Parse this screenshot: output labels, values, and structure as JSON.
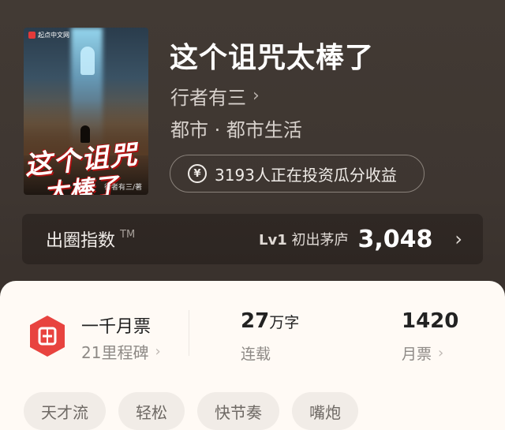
{
  "book": {
    "cover": {
      "brand": "起点中文网",
      "title_line1": "这个诅咒",
      "title_line2": "太棒了",
      "author_tag": "行者有三/著"
    },
    "title": "这个诅咒太棒了",
    "author": "行者有三",
    "category": "都市 · 都市生活",
    "invest_text": "3193人正在投资瓜分收益"
  },
  "index": {
    "label": "出圈指数",
    "tm": "TM",
    "level": "Lv1",
    "level_name": "初出茅庐",
    "value": "3,048"
  },
  "stats": {
    "ticket_title": "一千月票",
    "ticket_sub": "21里程碑",
    "words_value": "27",
    "words_unit": "万字",
    "words_label": "连载",
    "monthly_value": "1420",
    "monthly_label": "月票"
  },
  "tags": [
    "天才流",
    "轻松",
    "快节奏",
    "嘴炮"
  ],
  "colors": {
    "accent_red": "#e8433f",
    "card_bg": "#fffaf5"
  },
  "icons": {
    "chevron": "›",
    "yen": "¥"
  }
}
